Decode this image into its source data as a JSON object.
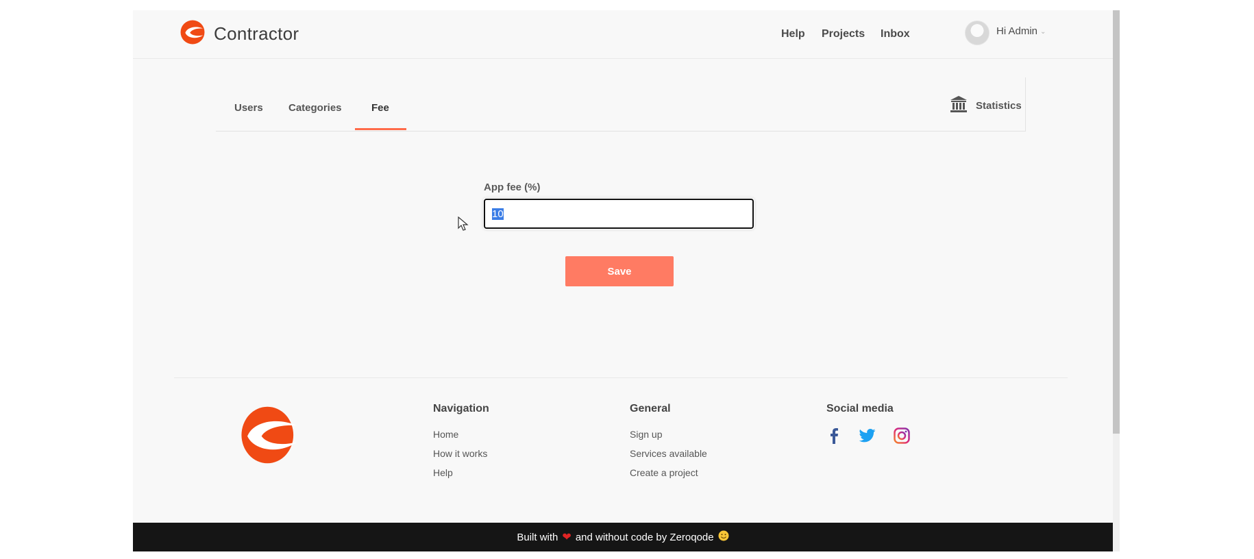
{
  "header": {
    "brand": "Contractor",
    "nav": [
      "Help",
      "Projects",
      "Inbox"
    ],
    "greeting": "Hi Admin"
  },
  "tabs": [
    "Users",
    "Categories",
    "Fee"
  ],
  "active_tab": "Fee",
  "statistics_label": "Statistics",
  "form": {
    "label": "App fee (%)",
    "value": "10",
    "save_label": "Save"
  },
  "footer": {
    "navigation": {
      "heading": "Navigation",
      "links": [
        "Home",
        "How it works",
        "Help"
      ]
    },
    "general": {
      "heading": "General",
      "links": [
        "Sign up",
        "Services available",
        "Create a project"
      ]
    },
    "social": {
      "heading": "Social media",
      "icons": [
        "facebook-icon",
        "twitter-icon",
        "instagram-icon"
      ]
    }
  },
  "bottom_bar": {
    "prefix": "Built with",
    "suffix": "and without code by Zeroqode"
  },
  "colors": {
    "accent": "#ff6b4a",
    "save_button": "#ff7b63",
    "logo": "#f04a14",
    "bottom_bar": "#151515"
  }
}
